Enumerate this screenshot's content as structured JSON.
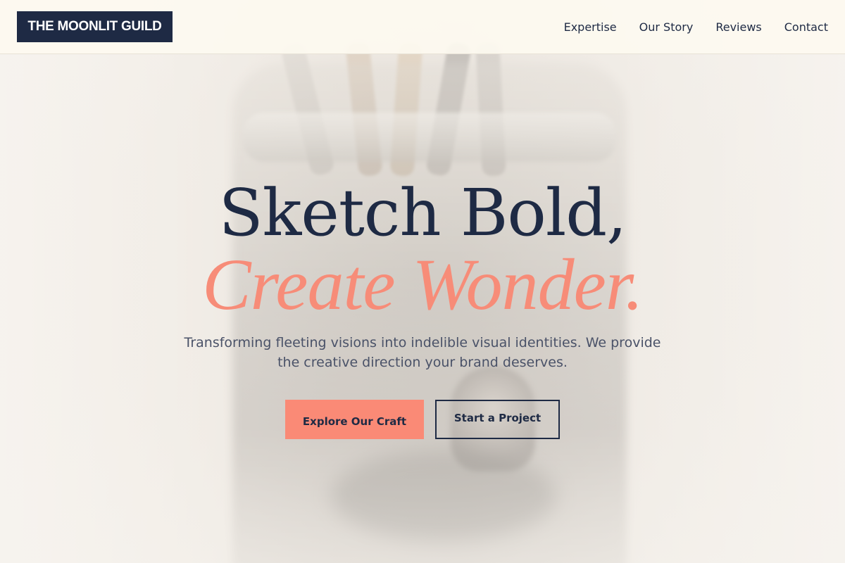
{
  "brand": {
    "logo_text": "THE MOONLIT GUILD"
  },
  "nav": {
    "items": [
      {
        "label": "Expertise"
      },
      {
        "label": "Our Story"
      },
      {
        "label": "Reviews"
      },
      {
        "label": "Contact"
      }
    ]
  },
  "hero": {
    "headline": "Sketch Bold,",
    "headline_accent": "Create Wonder.",
    "lede": "Transforming fleeting visions into indelible visual identities. We provide the creative direction your brand deserves.",
    "primary_cta": "Explore Our Craft",
    "secondary_cta": "Start a Project"
  },
  "colors": {
    "navy": "#1e2a44",
    "coral": "#fa8a76",
    "header_bg": "#fdfaf0"
  },
  "background": {
    "image": "faded-photo-paintbrush-jar"
  }
}
